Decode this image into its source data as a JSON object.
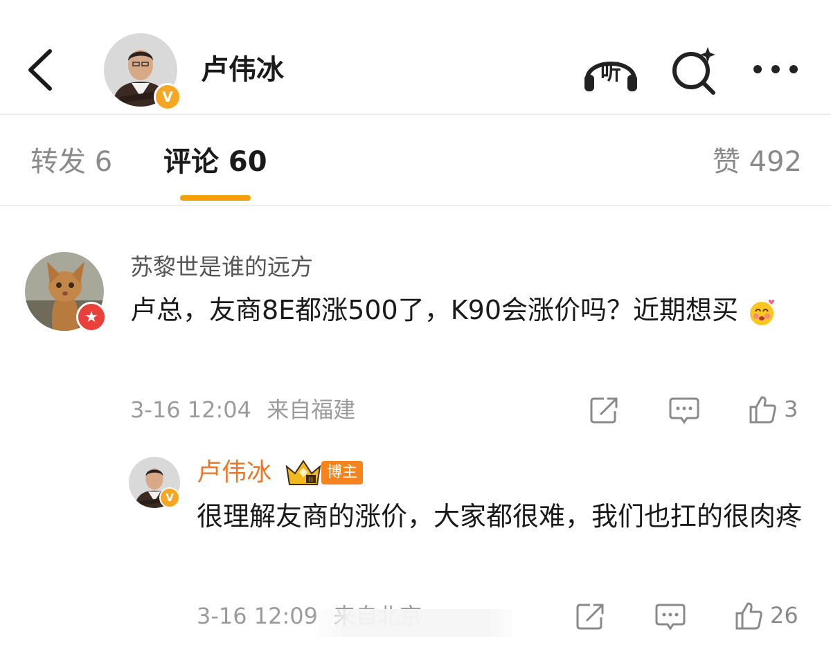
{
  "header": {
    "back_icon": "chevron-left-icon",
    "user_name": "卢伟冰",
    "verified_badge": "V",
    "listen_label": "听",
    "search_icon": "search-sparkle-icon",
    "more_icon": "more-horizontal-icon"
  },
  "tabs": {
    "repost": "转发 6",
    "comment": "评论 60",
    "like": "赞 492",
    "active": "comment",
    "accent_color": "#f5a000"
  },
  "comment": {
    "username": "苏黎世是谁的远方",
    "text": "卢总，友商8E都涨500了，K90会涨价吗？近期想买",
    "emoji": "blush-emoji-icon",
    "time": "3-16 12:04",
    "location": "来自福建",
    "share_icon": "share-icon",
    "reply_icon": "comment-icon",
    "like_icon": "thumbs-up-icon",
    "like_count": "3"
  },
  "reply": {
    "username": "卢伟冰",
    "crown_icon": "crown-badge-icon",
    "role_badge": "博主",
    "text": "很理解友商的涨价，大家都很难，我们也扛的很肉疼",
    "time": "3-16 12:09",
    "location": "来自北京",
    "like_count": "26"
  },
  "colors": {
    "verified": "#f5a623",
    "reply_name": "#e8792a",
    "role_badge": "#f5841f"
  }
}
